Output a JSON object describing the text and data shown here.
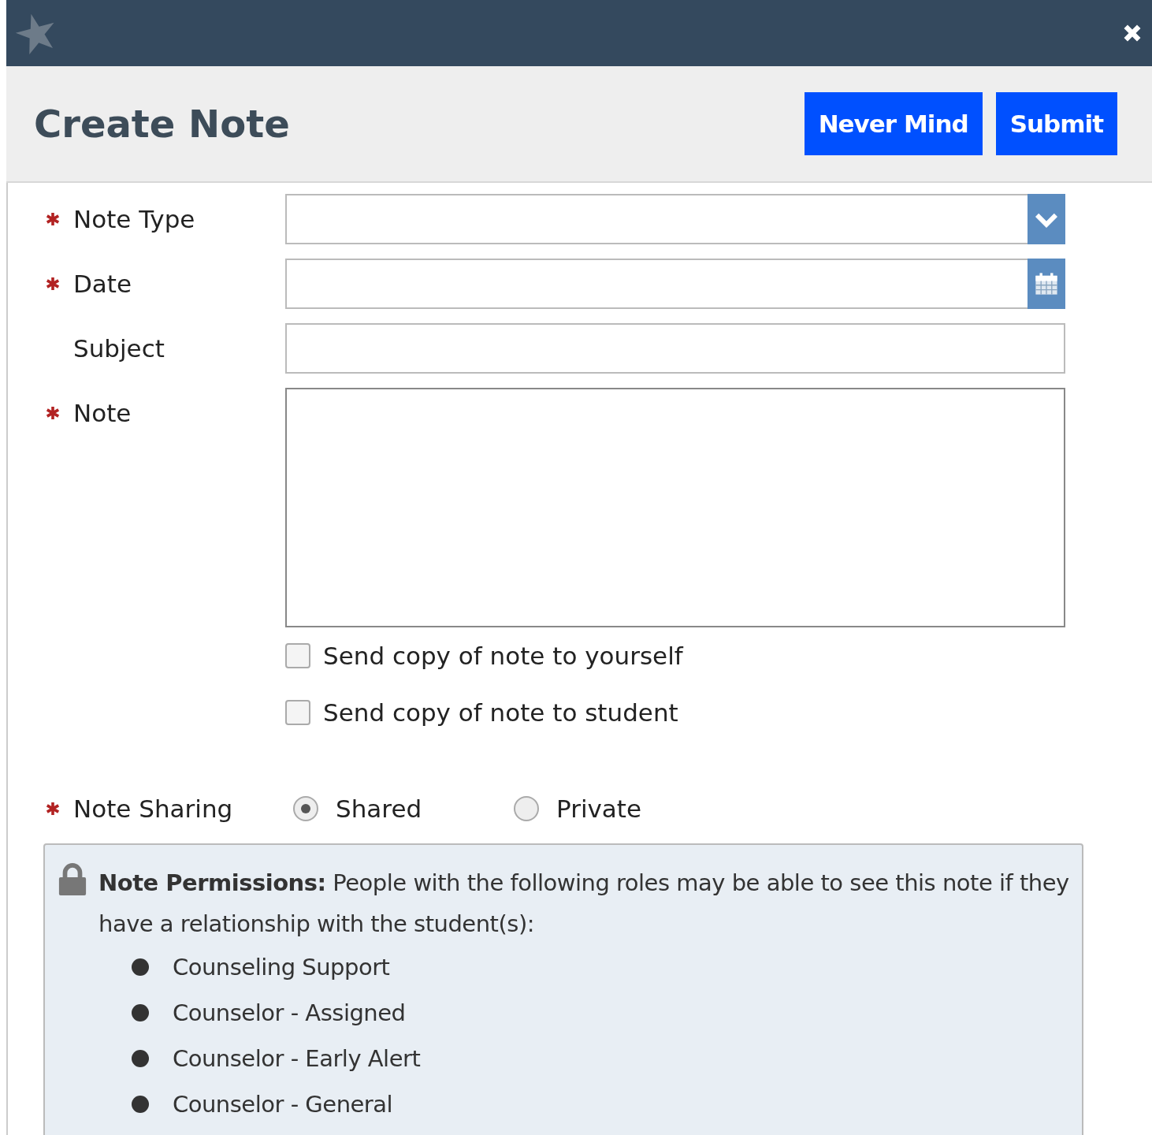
{
  "header": {
    "title": "Create Note",
    "buttons": [
      {
        "label": "Never Mind"
      },
      {
        "label": "Submit"
      }
    ]
  },
  "fields": [
    {
      "label": "Note Type",
      "required": true,
      "kind": "select"
    },
    {
      "label": "Date",
      "required": true,
      "kind": "date"
    },
    {
      "label": "Subject",
      "required": false,
      "kind": "text"
    },
    {
      "label": "Note",
      "required": true,
      "kind": "textarea"
    }
  ],
  "checkboxes": [
    {
      "label": "Send copy of note to yourself",
      "checked": false
    },
    {
      "label": "Send copy of note to student",
      "checked": false
    }
  ],
  "sharing": {
    "label": "Note Sharing",
    "required": true,
    "options": [
      {
        "label": "Shared",
        "selected": true
      },
      {
        "label": "Private",
        "selected": false
      }
    ]
  },
  "permissions": {
    "text": "**Note Permissions:** People with the following roles may be able to see this note if they have a relationship with the student(s):",
    "roles": [
      "Counseling Support",
      "Counselor - Assigned",
      "Counselor - Early Alert",
      "Counselor - General"
    ]
  }
}
